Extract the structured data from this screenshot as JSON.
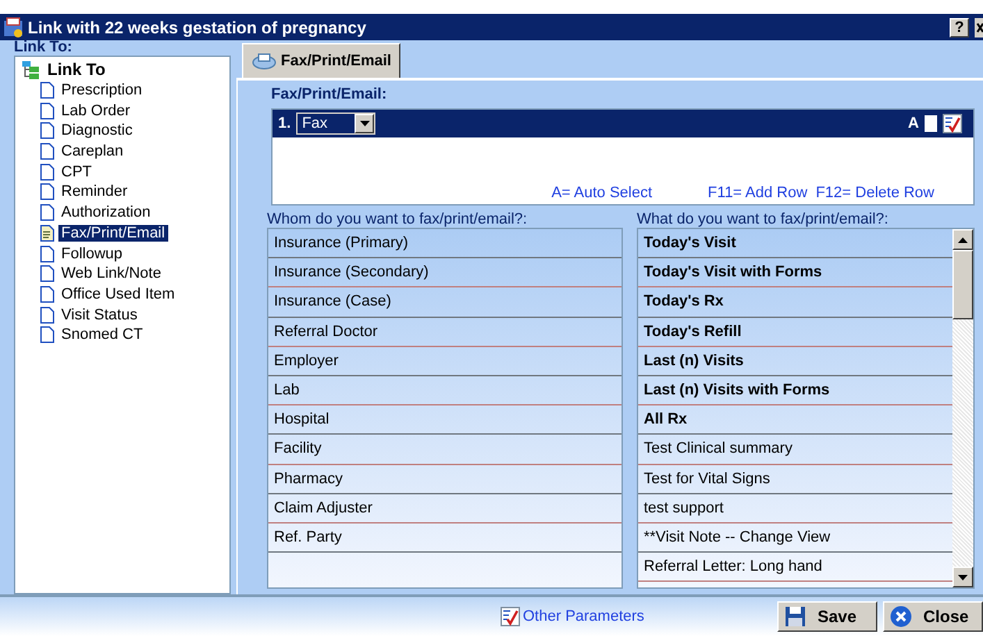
{
  "window": {
    "title": "Link with 22 weeks gestation of pregnancy",
    "help_button": "?"
  },
  "sidebar": {
    "label": "Link To:",
    "root": {
      "label": "Link To",
      "children": [
        {
          "label": "Prescription",
          "selected": false
        },
        {
          "label": "Lab Order",
          "selected": false
        },
        {
          "label": "Diagnostic",
          "selected": false
        },
        {
          "label": "Careplan",
          "selected": false
        },
        {
          "label": "CPT",
          "selected": false
        },
        {
          "label": "Reminder",
          "selected": false
        },
        {
          "label": "Authorization",
          "selected": false
        },
        {
          "label": "Fax/Print/Email",
          "selected": true
        },
        {
          "label": "Followup",
          "selected": false
        },
        {
          "label": "Web Link/Note",
          "selected": false
        },
        {
          "label": "Office Used Item",
          "selected": false
        },
        {
          "label": "Visit Status",
          "selected": false
        },
        {
          "label": "Snomed CT",
          "selected": false
        }
      ]
    }
  },
  "tabs": [
    {
      "label": "Fax/Print/Email",
      "selected": true
    }
  ],
  "fax_box": {
    "title": "Fax/Print/Email:",
    "rows": [
      {
        "number": "1.",
        "method": "Fax",
        "auto_label": "A",
        "auto_checked": false
      }
    ],
    "hints": [
      "A= Auto Select",
      "F11= Add Row",
      "F12= Delete Row"
    ]
  },
  "whom": {
    "title": "Whom do you want to fax/print/email?:",
    "items": [
      "Insurance (Primary)",
      "Insurance (Secondary)",
      "Insurance (Case)",
      "Referral Doctor",
      "Employer",
      "Lab",
      "Hospital",
      "Facility",
      "Pharmacy",
      "Claim Adjuster",
      "Ref. Party"
    ]
  },
  "what": {
    "title": "What do you want to fax/print/email?:",
    "items": [
      {
        "label": "Today's Visit",
        "bold": true
      },
      {
        "label": "Today's Visit with Forms",
        "bold": true
      },
      {
        "label": "Today's Rx",
        "bold": true
      },
      {
        "label": "Today's Refill",
        "bold": true
      },
      {
        "label": "Last (n) Visits",
        "bold": true
      },
      {
        "label": "Last (n) Visits with Forms",
        "bold": true
      },
      {
        "label": "All Rx",
        "bold": true
      },
      {
        "label": "Test Clinical summary",
        "bold": false
      },
      {
        "label": "Test for Vital Signs",
        "bold": false
      },
      {
        "label": "test support",
        "bold": false
      },
      {
        "label": "**Visit Note -- Change View",
        "bold": false
      },
      {
        "label": "Referral Letter: Long hand",
        "bold": false
      }
    ]
  },
  "footer": {
    "link": "Other Parameters",
    "buttons": [
      {
        "kind": "save",
        "label": "Save"
      },
      {
        "kind": "close",
        "label": "Close"
      }
    ]
  }
}
